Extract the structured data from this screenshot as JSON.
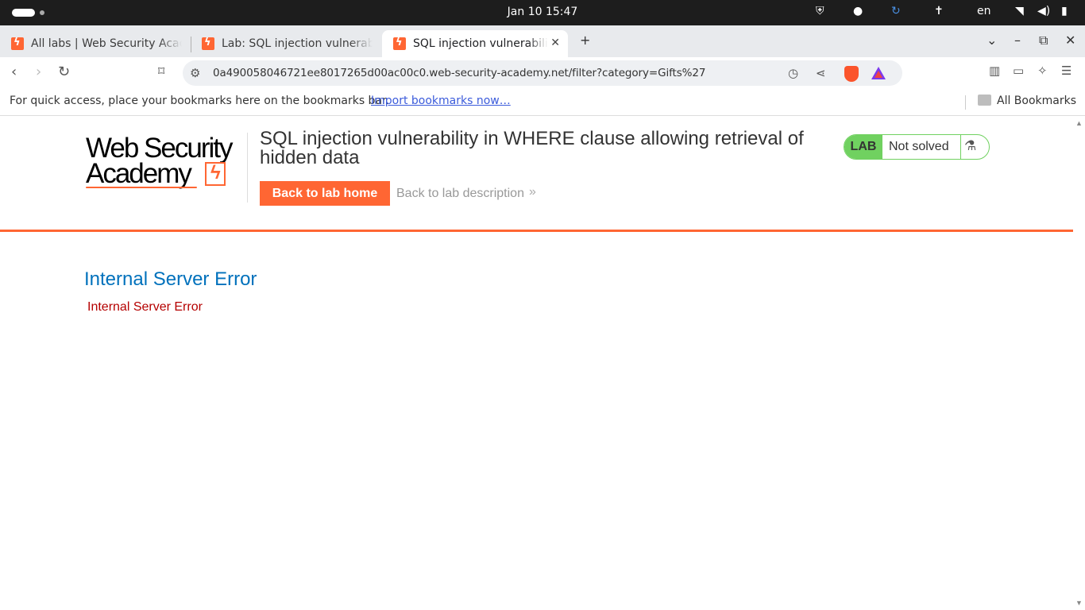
{
  "os": {
    "clock": "Jan 10  15:47",
    "language": "en"
  },
  "browser": {
    "tabs": [
      {
        "title": "All labs | Web Security Academy",
        "active": false
      },
      {
        "title": "Lab: SQL injection vulnerability in WHERE clause",
        "active": false
      },
      {
        "title": "SQL injection vulnerability in WHERE clause",
        "active": true
      }
    ],
    "url": "0a490058046721ee8017265d00ac00c0.web-security-academy.net/filter?category=Gifts%27",
    "bookmarks_hint": "For quick access, place your bookmarks here on the bookmarks bar.",
    "import_link": "Import bookmarks now…",
    "all_bookmarks": "All Bookmarks"
  },
  "page": {
    "logo_line1": "Web Security",
    "logo_line2": "Academy",
    "title": "SQL injection vulnerability in WHERE clause allowing retrieval of hidden data",
    "back_home": "Back to lab home",
    "back_description": "Back to lab description",
    "lab_badge": "LAB",
    "lab_status": "Not solved",
    "error_heading": "Internal Server Error",
    "error_text": "Internal Server Error"
  }
}
